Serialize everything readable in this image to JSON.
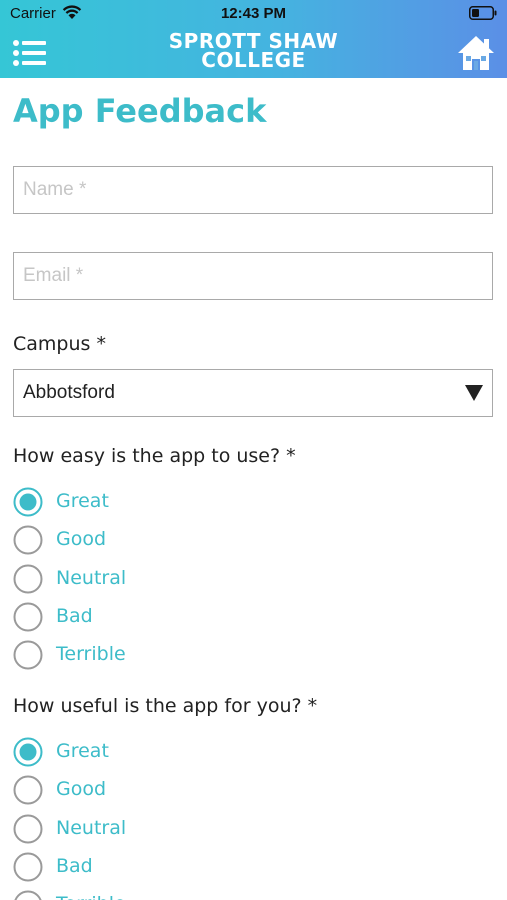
{
  "status_bar": {
    "carrier": "Carrier",
    "time": "12:43 PM"
  },
  "header": {
    "logo_line1": "SPROTT SHAW",
    "logo_line2": "COLLEGE",
    "menu_icon": "hamburger-menu-icon",
    "home_icon": "home-icon"
  },
  "colors": {
    "accent": "#3dbcc9",
    "header_gradient_start": "#35c6d6",
    "header_gradient_end": "#5b8fe6"
  },
  "page": {
    "title": "App Feedback"
  },
  "form": {
    "name_placeholder": "Name *",
    "email_placeholder": "Email *",
    "campus_label": "Campus *",
    "campus_selected": "Abbotsford",
    "q1": {
      "question": "How easy is the app to use? *",
      "options": [
        "Great",
        "Good",
        "Neutral",
        "Bad",
        "Terrible"
      ],
      "selected": "Great"
    },
    "q2": {
      "question": "How useful is the app for you? *",
      "options": [
        "Great",
        "Good",
        "Neutral",
        "Bad",
        "Terrible"
      ],
      "selected": "Great"
    }
  }
}
